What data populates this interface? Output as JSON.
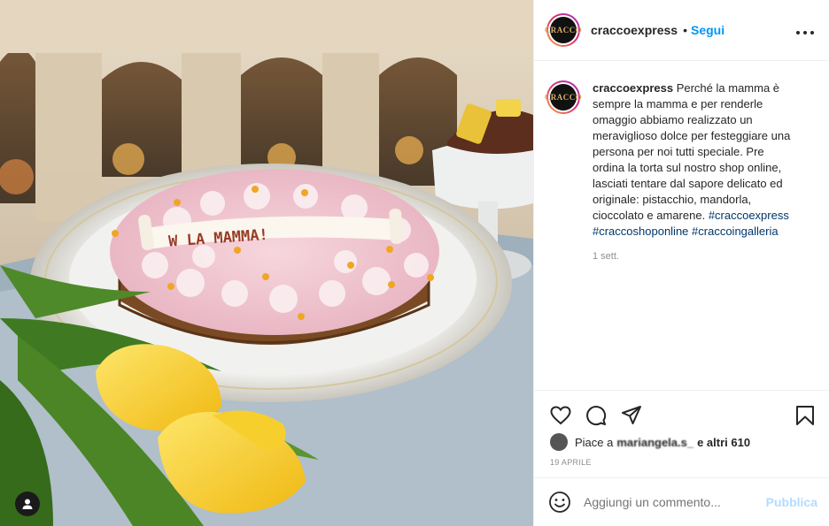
{
  "post": {
    "username": "craccoexpress",
    "follow_label": "Segui",
    "separator": "•",
    "more_label": "•••",
    "logo_text": "CRACCO"
  },
  "caption": {
    "username": "craccoexpress",
    "text": "Perché la mamma è sempre la mamma e per renderle omaggio abbiamo realizzato un meraviglioso dolce per festeggiare una persona per noi tutti speciale. Pre ordina la torta sul nostro shop online, lasciati tentare dal sapore delicato ed originale: pistacchio, mandorla, cioccolato e amarene.",
    "hashtags": [
      "#craccoexpress",
      "#craccoshoponline",
      "#craccoingalleria"
    ],
    "time_ago": "1 sett."
  },
  "photo": {
    "cake_text": "W LA MAMMA!",
    "icons": [
      "user-icon"
    ]
  },
  "actions": {
    "icons": [
      "heart-icon",
      "comment-icon",
      "share-icon",
      "bookmark-icon"
    ],
    "likes_prefix": "Piace a",
    "likes_user": "mariangela.s_",
    "likes_suffix": "e altri 610",
    "date": "19 APRILE"
  },
  "comment_box": {
    "placeholder": "Aggiungi un commento...",
    "publish_label": "Pubblica"
  },
  "colors": {
    "accent": "#0095f6",
    "publish_disabled": "#b3dbff",
    "hashtag": "#00376b",
    "muted": "#8e8e8e"
  }
}
